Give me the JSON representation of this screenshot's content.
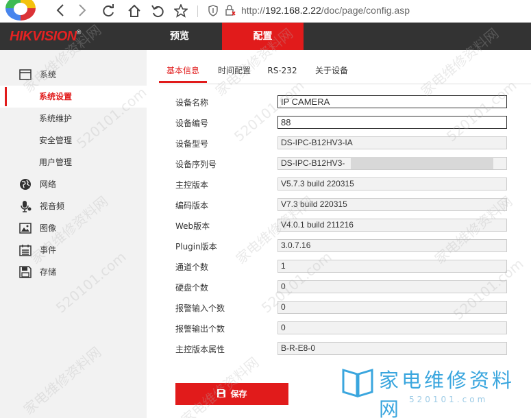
{
  "browser": {
    "url_prefix": "http://",
    "url_host": "192.168.2.22",
    "url_path": "/doc/page/config.asp"
  },
  "header": {
    "logo_text": "HIKVISION",
    "logo_mark": "®",
    "tabs": [
      {
        "label": "预览"
      },
      {
        "label": "配置"
      }
    ]
  },
  "sidebar": {
    "items": [
      {
        "label": "系统",
        "icon": "monitor-icon"
      },
      {
        "label": "系统设置"
      },
      {
        "label": "系统维护"
      },
      {
        "label": "安全管理"
      },
      {
        "label": "用户管理"
      },
      {
        "label": "网络",
        "icon": "globe-icon"
      },
      {
        "label": "视音频",
        "icon": "microphone-icon"
      },
      {
        "label": "图像",
        "icon": "image-icon"
      },
      {
        "label": "事件",
        "icon": "calendar-icon"
      },
      {
        "label": "存储",
        "icon": "save-icon"
      }
    ]
  },
  "tabs": [
    {
      "label": "基本信息"
    },
    {
      "label": "时间配置"
    },
    {
      "label": "RS-232"
    },
    {
      "label": "关于设备"
    }
  ],
  "form": {
    "rows": [
      {
        "label": "设备名称",
        "value": "IP CAMERA"
      },
      {
        "label": "设备编号",
        "value": "88"
      },
      {
        "label": "设备型号",
        "value": "DS-IPC-B12HV3-IA"
      },
      {
        "label": "设备序列号",
        "value": "DS-IPC-B12HV3-"
      },
      {
        "label": "主控版本",
        "value": "V5.7.3 build 220315"
      },
      {
        "label": "编码版本",
        "value": "V7.3 build 220315"
      },
      {
        "label": "Web版本",
        "value": "V4.0.1 build 211216"
      },
      {
        "label": "Plugin版本",
        "value": "3.0.7.16"
      },
      {
        "label": "通道个数",
        "value": "1"
      },
      {
        "label": "硬盘个数",
        "value": "0"
      },
      {
        "label": "报警输入个数",
        "value": "0"
      },
      {
        "label": "报警输出个数",
        "value": "0"
      },
      {
        "label": "主控版本属性",
        "value": "B-R-E8-0"
      }
    ],
    "save_label": "保存"
  },
  "watermark": {
    "brand": "家电维修资料网",
    "site": "520101.com",
    "texts": [
      "家电维修资料网",
      "520101.com"
    ]
  },
  "colors": {
    "accent": "#e11b1b",
    "header_bg": "#333333",
    "sidebar_bg": "#f2f2f2"
  }
}
